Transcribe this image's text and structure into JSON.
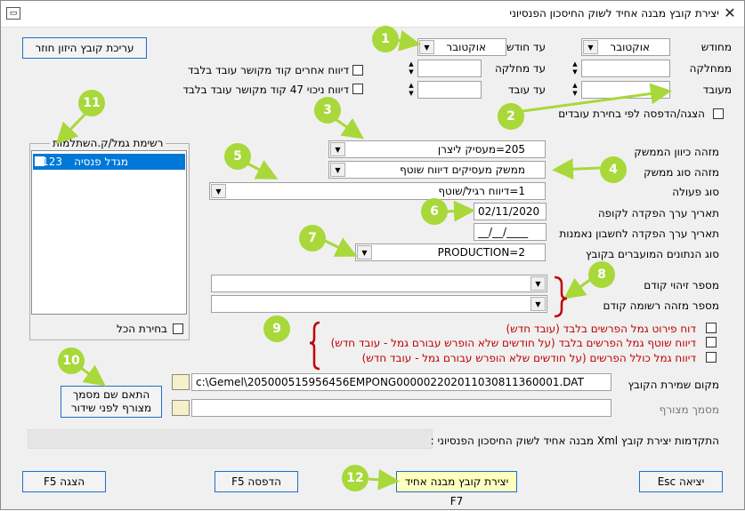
{
  "window": {
    "title": "יצירת קובץ מבנה אחיד לשוק החיסכון הפנסיוני",
    "icon": "app-window-icon",
    "close": "✕"
  },
  "buttons": {
    "edit_return_file": "עריכת קובץ היזון חוזר",
    "show": "הצגה F5",
    "print": "הדפסה F5",
    "create_file": "יצירת קובץ מבנה אחיד F7",
    "exit": "יציאה Esc",
    "match_doc_name": "התאם שם מסמך מצורף לפני שידור"
  },
  "filters": {
    "from_month_label": "מחודש",
    "from_month_value": "אוקטובר",
    "to_month_label": "עד חודש",
    "to_month_value": "אוקטובר",
    "from_dept_label": "ממחלקה",
    "to_dept_label": "עד מחלקה",
    "from_emp_label": "מעובד",
    "to_emp_label": "עד עובד",
    "report_others": "דיווח אחרים קוד מקושר עובד בלבד",
    "report_deduct47": "דיווח ניכוי 47 קוד מקושר עובד בלבד",
    "show_print_by_emp": "הצגה/הדפסה לפי בחירת עובדים"
  },
  "list": {
    "title": "רשימת גמל/ק.השתלמות",
    "items": [
      {
        "code": "123",
        "name": "מגדל פנסיה"
      }
    ],
    "select_all": "בחירת הכל"
  },
  "form": {
    "employer_dir_label": "מזהה כיוון הממשק",
    "employer_dir_value": "205=מעסיק ליצרן",
    "interface_type_label": "מזהה סוג ממשק",
    "interface_type_value": "ממשק מעסיקים דיווח שוטף",
    "action_type_label": "סוג פעולה",
    "action_type_value": "1=דיווח רגיל/שוטף",
    "deposit_date_label": "תאריך ערך הפקדה לקופה",
    "deposit_date_value": "02/11/2020",
    "trust_date_label": "תאריך ערך הפקדה לחשבון נאמנות",
    "trust_date_value": "__/__/____",
    "data_type_label": "סוג הנתונים המועברים בקובץ",
    "data_type_value": "PRODUCTION=2",
    "prev_id_label": "מספר זיהוי קודם",
    "prev_record_label": "מספר מזהה רשומה קודם",
    "report_details": "דוח פירוט גמל הפרשים בלבד (עובד חדש)",
    "report_current_diff": "דיווח שוטף גמל הפרשים בלבד (על חודשים שלא הופרש עבורם גמל - עובד חדש)",
    "report_inclusive": "דיווח גמל כולל הפרשים (על חודשים שלא הופרש עבורם גמל - עובד חדש)",
    "save_path_label": "מקום שמירת הקובץ",
    "save_path_value": "c:\\Gemel\\205000515956456EMPONG000002202011030811360001.DAT",
    "attached_doc_label": "מסמך מצורף",
    "progress_label": "התקדמות יצירת קובץ Xml מבנה אחיד לשוק החיסכון הפנסיוני :"
  },
  "annotations": [
    "1",
    "2",
    "3",
    "4",
    "5",
    "6",
    "7",
    "8",
    "9",
    "10",
    "11",
    "12"
  ],
  "colors": {
    "annotation": "#a8d83a",
    "selection": "#0078d7",
    "bracket": "#c00000",
    "highlight_button": "#ffffc0"
  }
}
